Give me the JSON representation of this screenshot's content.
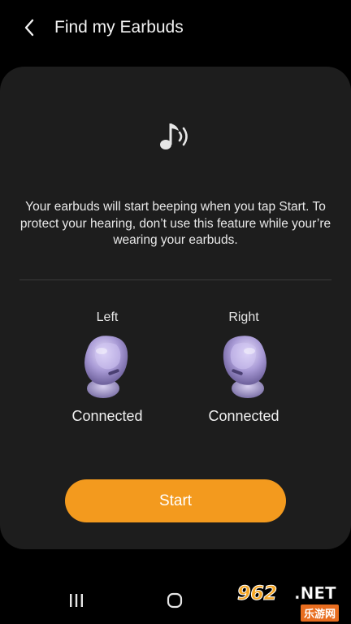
{
  "header": {
    "title": "Find my Earbuds"
  },
  "card": {
    "info_text": "Your earbuds will start beeping when you tap Start. To protect your hearing, don’t use this feature while your’re wearing your earbuds.",
    "left": {
      "label": "Left",
      "status": "Connected"
    },
    "right": {
      "label": "Right",
      "status": "Connected"
    },
    "start_label": "Start"
  },
  "navbar": {
    "recent_icon": "recent-apps-icon",
    "home_icon": "home-icon"
  },
  "watermark": {
    "brand": "962",
    "net": ".NET",
    "sub": "乐游网"
  },
  "colors": {
    "accent": "#f39a1e",
    "card_bg": "#1d1d1d",
    "background": "#000000"
  }
}
